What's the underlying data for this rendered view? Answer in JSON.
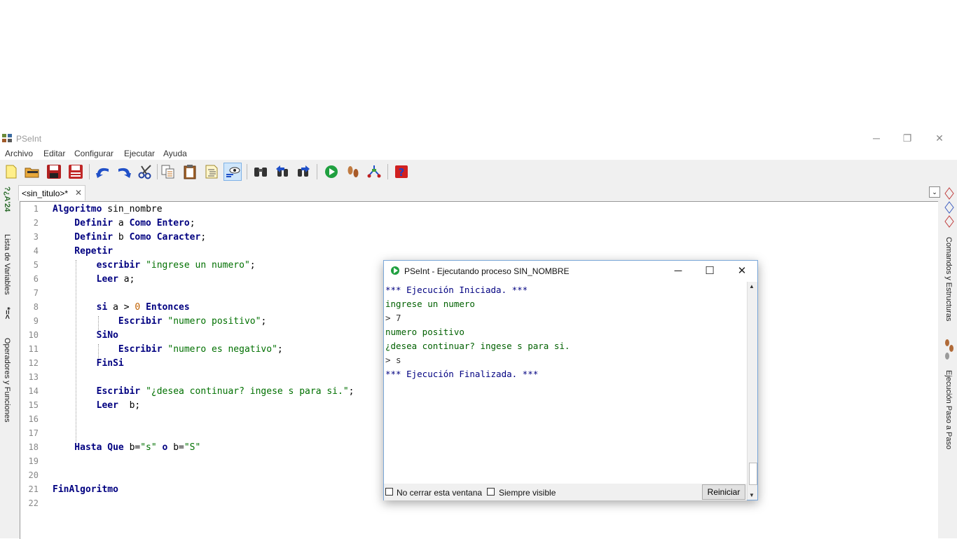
{
  "window": {
    "title": "PSeInt",
    "minimize_glyph": "─",
    "restore_glyph": "❐",
    "close_glyph": "✕"
  },
  "menu": [
    "Archivo",
    "Editar",
    "Configurar",
    "Ejecutar",
    "Ayuda"
  ],
  "toolbar": {
    "icons": [
      "new-file-icon",
      "open-folder-icon",
      "save-icon",
      "save-as-icon",
      "undo-icon",
      "redo-icon",
      "cut-icon",
      "copy-icon",
      "paste-icon",
      "indent-icon",
      "view-icon",
      "find-icon",
      "find-prev-icon",
      "find-next-icon",
      "run-icon",
      "step-by-step-icon",
      "flowchart-icon",
      "help-icon"
    ]
  },
  "left_panel": {
    "vars_label": "Lista de Variables",
    "ops_label": "Operadores y Funciones",
    "vars_glyph": "*=<",
    "ops_glyph": "?¿A'24"
  },
  "right_panel": {
    "commands_label": "Comandos y Estructuras",
    "step_label": "Ejecución Paso a Paso"
  },
  "tab": {
    "label": "<sin_titulo>*",
    "close": "✕",
    "dropdown": "⌄"
  },
  "editor": {
    "line_numbers": [
      "1",
      "2",
      "3",
      "4",
      "5",
      "6",
      "7",
      "8",
      "9",
      "10",
      "11",
      "12",
      "13",
      "14",
      "15",
      "16",
      "17",
      "18",
      "19",
      "20",
      "21",
      "22"
    ],
    "lines": [
      [
        {
          "t": "Algoritmo",
          "c": "kw"
        },
        {
          "t": " sin_nombre",
          "c": "op"
        }
      ],
      [
        {
          "t": "    Definir",
          "c": "kw"
        },
        {
          "t": " a ",
          "c": "op"
        },
        {
          "t": "Como",
          "c": "kw"
        },
        {
          "t": " ",
          "c": "op"
        },
        {
          "t": "Entero",
          "c": "kw"
        },
        {
          "t": ";",
          "c": "op"
        }
      ],
      [
        {
          "t": "    Definir",
          "c": "kw"
        },
        {
          "t": " b ",
          "c": "op"
        },
        {
          "t": "Como",
          "c": "kw"
        },
        {
          "t": " ",
          "c": "op"
        },
        {
          "t": "Caracter",
          "c": "kw"
        },
        {
          "t": ";",
          "c": "op"
        }
      ],
      [
        {
          "t": "    Repetir",
          "c": "kw"
        }
      ],
      [
        {
          "t": "        escribir",
          "c": "kw"
        },
        {
          "t": " ",
          "c": "op"
        },
        {
          "t": "\"ingrese un numero\"",
          "c": "st"
        },
        {
          "t": ";",
          "c": "op"
        }
      ],
      [
        {
          "t": "        Leer",
          "c": "kw"
        },
        {
          "t": " a;",
          "c": "op"
        }
      ],
      [],
      [
        {
          "t": "        si",
          "c": "kw"
        },
        {
          "t": " a > ",
          "c": "op"
        },
        {
          "t": "0",
          "c": "nm"
        },
        {
          "t": " ",
          "c": "op"
        },
        {
          "t": "Entonces",
          "c": "kw"
        }
      ],
      [
        {
          "t": "            Escribir",
          "c": "kw"
        },
        {
          "t": " ",
          "c": "op"
        },
        {
          "t": "\"numero positivo\"",
          "c": "st"
        },
        {
          "t": ";",
          "c": "op"
        }
      ],
      [
        {
          "t": "        SiNo",
          "c": "kw"
        }
      ],
      [
        {
          "t": "            Escribir",
          "c": "kw"
        },
        {
          "t": " ",
          "c": "op"
        },
        {
          "t": "\"numero es negativo\"",
          "c": "st"
        },
        {
          "t": ";",
          "c": "op"
        }
      ],
      [
        {
          "t": "        FinSi",
          "c": "kw"
        }
      ],
      [],
      [
        {
          "t": "        Escribir",
          "c": "kw"
        },
        {
          "t": " ",
          "c": "op"
        },
        {
          "t": "\"¿desea continuar? ingese s para si.\"",
          "c": "st"
        },
        {
          "t": ";",
          "c": "op"
        }
      ],
      [
        {
          "t": "        Leer",
          "c": "kw"
        },
        {
          "t": "  b;",
          "c": "op"
        }
      ],
      [],
      [],
      [
        {
          "t": "    Hasta Que",
          "c": "kw"
        },
        {
          "t": " b=",
          "c": "op"
        },
        {
          "t": "\"s\"",
          "c": "st"
        },
        {
          "t": " ",
          "c": "op"
        },
        {
          "t": "o",
          "c": "kw"
        },
        {
          "t": " b=",
          "c": "op"
        },
        {
          "t": "\"S\"",
          "c": "st"
        }
      ],
      [],
      [],
      [
        {
          "t": "FinAlgoritmo",
          "c": "kw"
        }
      ],
      []
    ]
  },
  "dialog": {
    "title": "PSeInt - Ejecutando proceso SIN_NOMBRE",
    "minimize_glyph": "─",
    "maximize_glyph": "☐",
    "close_glyph": "✕",
    "console": [
      {
        "t": "*** Ejecución Iniciada. ***",
        "c": "cinfo"
      },
      {
        "t": "ingrese un numero",
        "c": "cout"
      },
      {
        "t": "> 7",
        "c": "cin"
      },
      {
        "t": "numero positivo",
        "c": "cout"
      },
      {
        "t": "¿desea continuar? ingese s para si.",
        "c": "cout"
      },
      {
        "t": "> s",
        "c": "cin"
      },
      {
        "t": "*** Ejecución Finalizada. ***",
        "c": "cinfo"
      }
    ],
    "no_cerrar_label": "No cerrar esta ventana",
    "siempre_visible_label": "Siempre visible",
    "reiniciar_label": "Reiniciar",
    "scroll_up": "▲",
    "scroll_down": "▼"
  }
}
